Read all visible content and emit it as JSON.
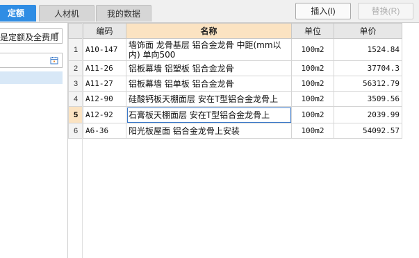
{
  "tabs": [
    {
      "label": "定额",
      "active": true
    },
    {
      "label": "人材机",
      "active": false
    },
    {
      "label": "我的数据",
      "active": false
    }
  ],
  "buttons": {
    "insert": "插入(I)",
    "replace": "替换(R)"
  },
  "left_panel": {
    "dropdown_value": "是定额及全费用",
    "search_placeholder": "",
    "search_icon": "calendar-search-icon"
  },
  "table": {
    "headers": {
      "code": "编码",
      "name": "名称",
      "unit": "单位",
      "price": "单价"
    },
    "selected_row": 5,
    "rows": [
      {
        "no": "1",
        "code": "A10-147",
        "name": "墙饰面 龙骨基层 铝合金龙骨 中距(mm以内) 单向500",
        "unit": "100m2",
        "price": "1524.84"
      },
      {
        "no": "2",
        "code": "A11-26",
        "name": "铝板幕墙 铝塑板 铝合金龙骨",
        "unit": "100m2",
        "price": "37704.3"
      },
      {
        "no": "3",
        "code": "A11-27",
        "name": "铝板幕墙 铝单板 铝合金龙骨",
        "unit": "100m2",
        "price": "56312.79"
      },
      {
        "no": "4",
        "code": "A12-90",
        "name": "硅酸钙板天棚面层 安在T型铝合金龙骨上",
        "unit": "100m2",
        "price": "3509.56"
      },
      {
        "no": "5",
        "code": "A12-92",
        "name": "石膏板天棚面层 安在T型铝合金龙骨上",
        "unit": "100m2",
        "price": "2039.99"
      },
      {
        "no": "6",
        "code": "A6-36",
        "name": "阳光板屋面 铝合金龙骨上安装",
        "unit": "100m2",
        "price": "54092.57"
      }
    ]
  },
  "colors": {
    "active_tab": "#2f8de4",
    "name_header": "#fbe3c2",
    "selection": "#d8e8f7"
  }
}
